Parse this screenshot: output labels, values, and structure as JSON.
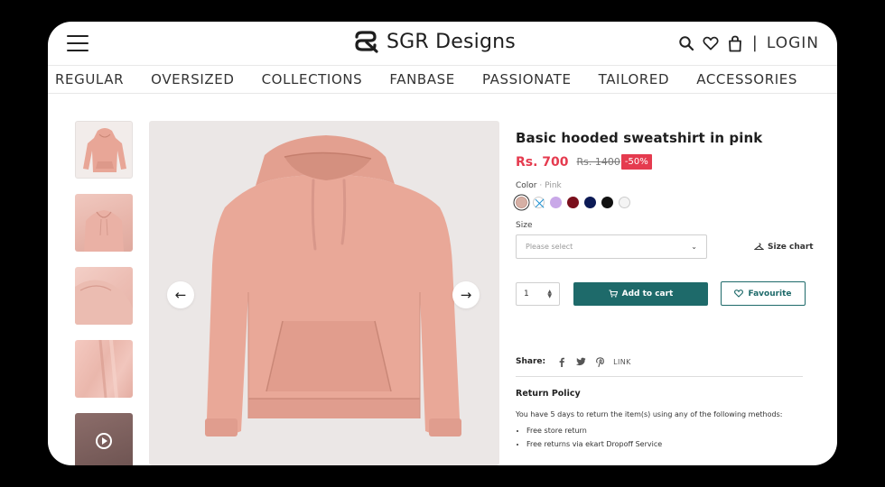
{
  "header": {
    "brand": "SGR Designs",
    "login": "LOGIN",
    "separator": "|"
  },
  "nav": {
    "items": [
      "REGULAR",
      "OVERSIZED",
      "COLLECTIONS",
      "FANBASE",
      "PASSIONATE",
      "TAILORED",
      "ACCESSORIES"
    ]
  },
  "product": {
    "title": "Basic hooded sweatshirt in pink",
    "price": "Rs. 700",
    "old_price": "Rs. 1400",
    "discount": "-50%",
    "color_label": "Color",
    "color_value": "Pink",
    "color_separator": " · ",
    "colors": [
      "#d6b0a5",
      "#ffffff",
      "#c9a8e8",
      "#7a0f1c",
      "#0c1a55",
      "#111111",
      "#f4f4f4"
    ],
    "size_label": "Size",
    "size_placeholder": "Please select",
    "size_chart": "Size chart",
    "quantity": "1",
    "add_to_cart": "Add to cart",
    "favourite": "Favourite"
  },
  "share": {
    "label": "Share:",
    "link": "LINK"
  },
  "return_policy": {
    "title": "Return Policy",
    "text": "You have 5 days to return the item(s) using any of the following methods:",
    "methods": [
      "Free store return",
      "Free returns via ekart Dropoff Service"
    ]
  },
  "colors": {
    "accent": "#1e6a6a",
    "sale": "#e53b4f",
    "hoodie": "#e8a697"
  }
}
